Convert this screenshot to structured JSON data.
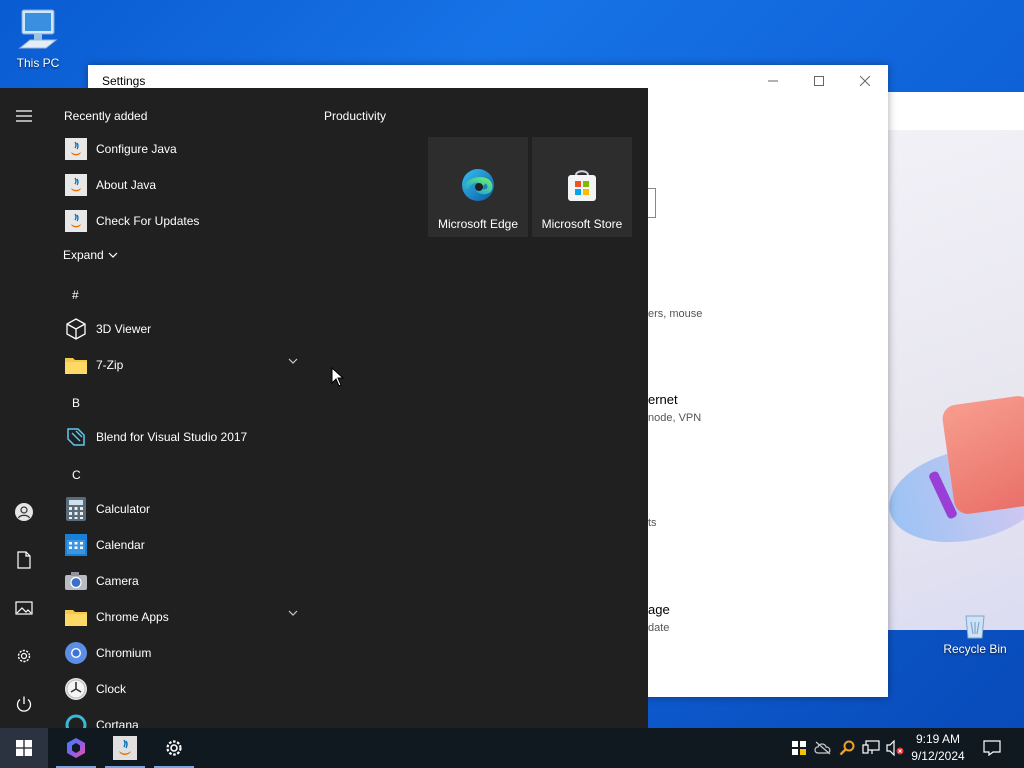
{
  "desktop": {
    "this_pc_label": "This PC",
    "recycle_bin_label": "Recycle Bin"
  },
  "settings_window": {
    "title": "Settings",
    "partial_texts": {
      "devices_desc": "ers, mouse",
      "network_title": "ernet",
      "network_desc": "node, VPN",
      "personalization_desc": "ts",
      "update_title": "age",
      "update_desc": "date"
    }
  },
  "start_menu": {
    "recently_added_title": "Recently added",
    "recent_apps": [
      {
        "label": "Configure Java",
        "icon": "java-icon"
      },
      {
        "label": "About Java",
        "icon": "java-icon"
      },
      {
        "label": "Check For Updates",
        "icon": "java-icon"
      }
    ],
    "expand_label": "Expand",
    "sections": {
      "hash": "#",
      "b": "B",
      "c": "C"
    },
    "apps": {
      "viewer3d": "3D Viewer",
      "zip7": "7-Zip",
      "blend": "Blend for Visual Studio 2017",
      "calculator": "Calculator",
      "calendar": "Calendar",
      "camera": "Camera",
      "chrome_apps": "Chrome Apps",
      "chromium": "Chromium",
      "clock": "Clock",
      "cortana": "Cortana"
    },
    "tiles_group_title": "Productivity",
    "tiles": [
      {
        "label": "Microsoft Edge",
        "icon": "edge-icon"
      },
      {
        "label": "Microsoft Store",
        "icon": "store-icon"
      }
    ]
  },
  "taskbar": {
    "time": "9:19 AM",
    "date": "9/12/2024"
  },
  "colors": {
    "start_bg": "#202020",
    "tile_bg": "#2d2d2d",
    "taskbar_bg": "#101820",
    "accent": "#0078d4"
  }
}
